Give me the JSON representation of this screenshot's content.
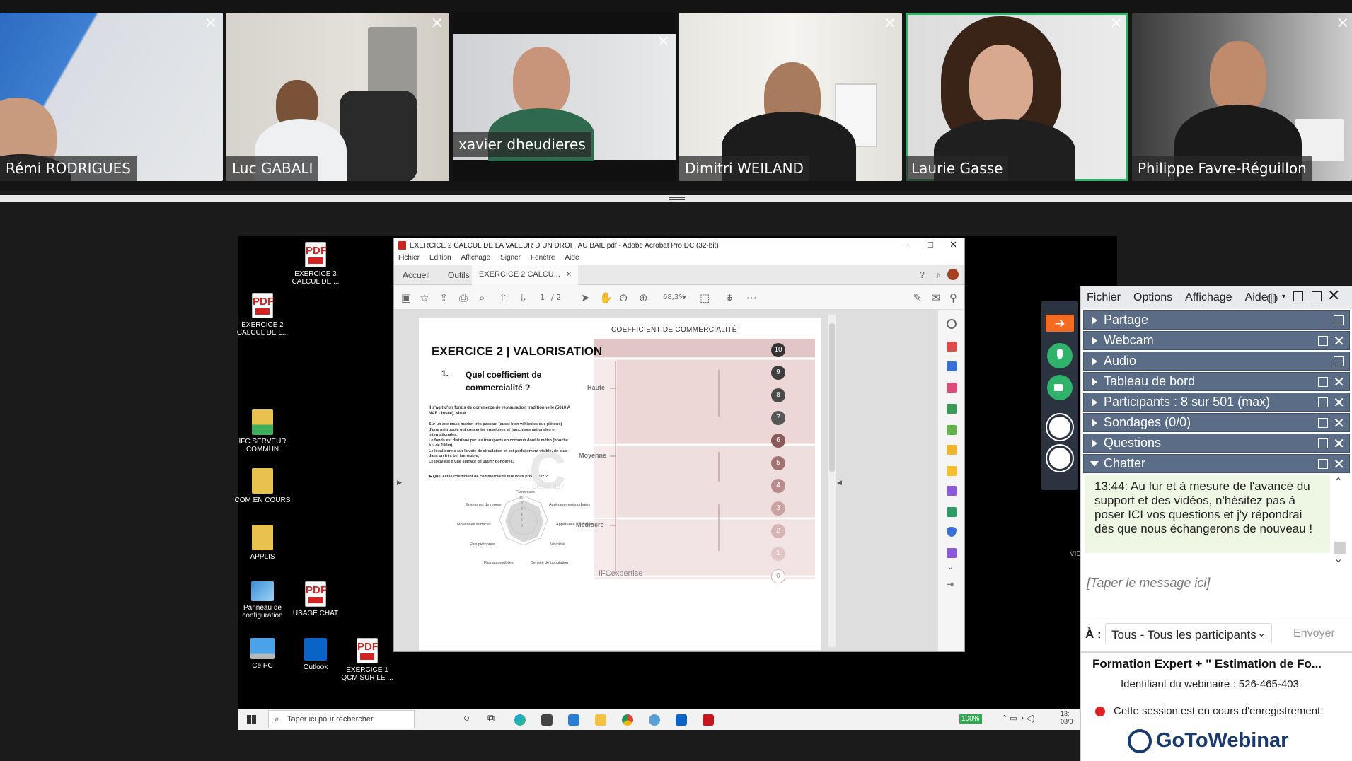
{
  "participants": [
    {
      "name": "Rémi RODRIGUES",
      "close": "×"
    },
    {
      "name": "Luc GABALI",
      "close": "×"
    },
    {
      "name": "xavier dheudieres",
      "close": "×"
    },
    {
      "name": "Dimitri WEILAND",
      "close": "×"
    },
    {
      "name": "Laurie Gasse",
      "close": "×"
    },
    {
      "name": "Philippe Favre-Réguillon",
      "close": "×"
    }
  ],
  "desktop": {
    "icons": [
      {
        "label1": "EXERCICE 3",
        "label2": "CALCUL DE ..."
      },
      {
        "label1": "EXERCICE 2",
        "label2": "CALCUL DE L..."
      },
      {
        "label1": "IFC SERVEUR",
        "label2": "COMMUN"
      },
      {
        "label1": "COM EN COURS",
        "label2": ""
      },
      {
        "label1": "APPLIS",
        "label2": ""
      },
      {
        "label1": "Panneau de",
        "label2": "configuration"
      },
      {
        "label1": "USAGE CHAT",
        "label2": ""
      },
      {
        "label1": "Ce PC",
        "label2": ""
      },
      {
        "label1": "Outlook",
        "label2": ""
      },
      {
        "label1": "EXERCICE 1",
        "label2": "QCM SUR LE ..."
      }
    ],
    "pdf_mark": "PDF"
  },
  "acrobat": {
    "title": "EXERCICE 2 CALCUL DE LA VALEUR D UN DROIT AU BAIL.pdf - Adobe Acrobat Pro DC (32-bit)",
    "menu": [
      "Fichier",
      "Edition",
      "Affichage",
      "Signer",
      "Fenêtre",
      "Aide"
    ],
    "tabs": {
      "home": "Accueil",
      "tools": "Outils",
      "doc": "EXERCICE 2 CALCU...",
      "doc_close": "×"
    },
    "page_current": "1",
    "page_total": "/ 2",
    "zoom": "68,3%"
  },
  "document": {
    "heading": "EXERCICE 2 | VALORISATION",
    "question_number": "1.",
    "question": "Quel coefficient de commercialité ?",
    "chart_title": "COEFFICIENT DE COMMERCIALITÉ",
    "intro": "Il s'agit d'un fonds de commerce de restauration traditionnelle (5610 A NAF - Insee), situé :",
    "bullets": [
      "Sur un axe mass market très passant (aussi bien véhicules que piétons) d'une métropole qui concentre enseignes et franchises nationales et internationales,",
      "Le fonds est distribué par les transports en commun dont le métro (bouche à ~ de 100m),",
      "Le local donne sur la voie de circulation et est parfaitement visible, de plus dans un très bel immeuble,",
      "Le local est d'une surface de 160m² pondérés."
    ],
    "ask": "▶ Quel est le coefficient de commercialité que vous privilégiez ?",
    "radar_labels": [
      "Franchises",
      "Aménagements urbains",
      "Apparence extérieure",
      "Visibilité",
      "Densité de population",
      "Flux automobiles",
      "Flux piétonnier",
      "Moyennes surfaces",
      "Enseignes de renom"
    ],
    "radar_ticks": [
      "10",
      "8",
      "6",
      "4",
      "2",
      "0"
    ],
    "levels": [
      "Haute",
      "Moyenne",
      "Médiocre"
    ],
    "coef_numbers": [
      "10",
      "9",
      "8",
      "7",
      "6",
      "5",
      "4",
      "3",
      "2",
      "1",
      "0"
    ],
    "watermark_letter": "C",
    "watermark_text": "Centre de F",
    "footer_logo": "IFCexpertise"
  },
  "taskbar": {
    "search_placeholder": "Taper ici pour rechercher",
    "battery": "100%",
    "clock_time": "13:",
    "clock_date": "03/0"
  },
  "gtw": {
    "menu": [
      "Fichier",
      "Options",
      "Affichage",
      "Aide"
    ],
    "sections": [
      {
        "label": "Partage"
      },
      {
        "label": "Webcam"
      },
      {
        "label": "Audio"
      },
      {
        "label": "Tableau de bord"
      },
      {
        "label": "Participants :  8 sur 501 (max)"
      },
      {
        "label": "Sondages (0/0)"
      },
      {
        "label": "Questions"
      },
      {
        "label": "Chatter"
      }
    ],
    "chat_message": "13:44: Au fur et à mesure de l'avancé du support et des vidéos, n'hésitez pas à poser ICI vos questions et j'y répondrai dès que nous échangerons de nouveau !",
    "input_placeholder": "[Taper le message ici]",
    "to_label": "À :",
    "to_value": "Tous - Tous les participants",
    "send": "Envoyer",
    "webinar_title": "Formation Expert + \" Estimation de Fo...",
    "webinar_id": "Identifiant du webinaire : 526-465-403",
    "recording": "Cette session est en cours d'enregistrement.",
    "brand": "GoToWebinar",
    "side_fragment": "VID"
  },
  "colors": {
    "active_border": "#2fb36a",
    "section_bg": "#5a6c86",
    "recording_dot": "#e02020",
    "brand_blue": "#1a3a6e"
  }
}
